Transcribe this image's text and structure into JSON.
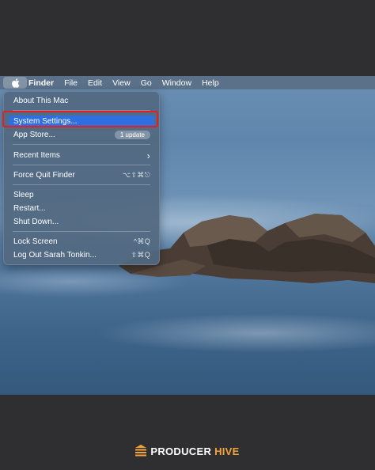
{
  "menubar": {
    "apple_icon": "apple-logo-icon",
    "items": [
      "Finder",
      "File",
      "Edit",
      "View",
      "Go",
      "Window",
      "Help"
    ]
  },
  "apple_menu": {
    "about": "About This Mac",
    "system_settings": "System Settings...",
    "app_store": "App Store...",
    "app_store_badge": "1 update",
    "recent_items": "Recent Items",
    "recent_items_arrow": "›",
    "force_quit": "Force Quit Finder",
    "force_quit_shortcut": "⌥⇧⌘⎋",
    "sleep": "Sleep",
    "restart": "Restart...",
    "shut_down": "Shut Down...",
    "lock_screen": "Lock Screen",
    "lock_screen_shortcut": "^⌘Q",
    "log_out": "Log Out Sarah Tonkin...",
    "log_out_shortcut": "⇧⌘Q"
  },
  "brand": {
    "name_part1": "PRODUCER",
    "name_part2": "HIVE",
    "logo_icon": "producer-hive-logo-icon"
  },
  "colors": {
    "highlight": "#2f6fe0",
    "callout": "#e11f26",
    "brand_accent": "#f2a43a",
    "frame": "#2f2f31"
  }
}
